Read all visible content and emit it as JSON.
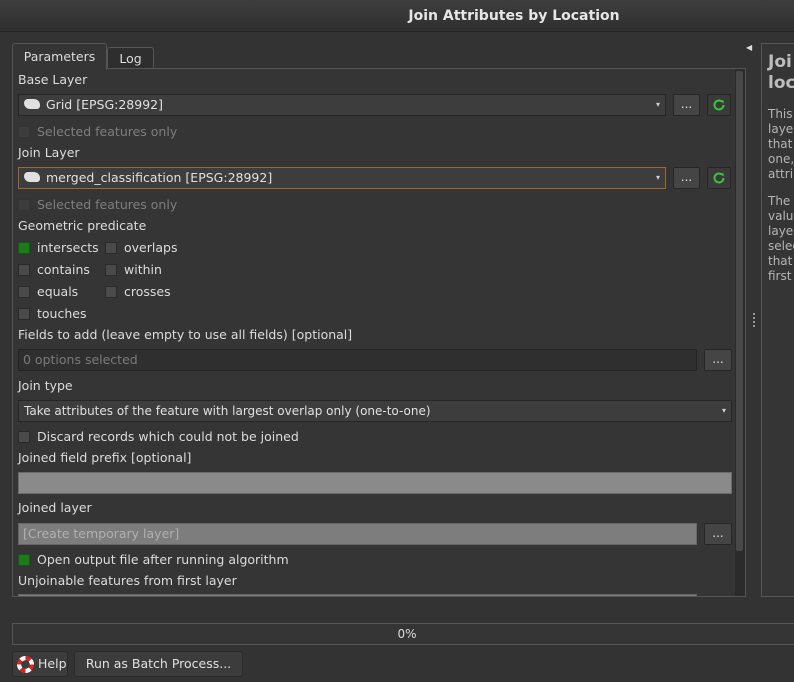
{
  "window": {
    "title": "Join Attributes by Location"
  },
  "tabs": [
    {
      "label": "Parameters"
    },
    {
      "label": "Log"
    }
  ],
  "base_layer": {
    "label": "Base Layer",
    "value": "Grid [EPSG:28992]",
    "selected_only_label": "Selected features only",
    "browse_label": "..."
  },
  "join_layer": {
    "label": "Join Layer",
    "value": "merged_classification [EPSG:28992]",
    "selected_only_label": "Selected features only",
    "browse_label": "..."
  },
  "geometric_predicate": {
    "label": "Geometric predicate",
    "options": [
      {
        "label": "intersects",
        "checked": true
      },
      {
        "label": "overlaps",
        "checked": false
      },
      {
        "label": "contains",
        "checked": false
      },
      {
        "label": "within",
        "checked": false
      },
      {
        "label": "equals",
        "checked": false
      },
      {
        "label": "crosses",
        "checked": false
      },
      {
        "label": "touches",
        "checked": false
      }
    ]
  },
  "fields_to_add": {
    "label": "Fields to add (leave empty to use all fields) [optional]",
    "placeholder": "0 options selected",
    "browse_label": "..."
  },
  "join_type": {
    "label": "Join type",
    "value": "Take attributes of the feature with largest overlap only (one-to-one)"
  },
  "discard": {
    "label": "Discard records which could not be joined",
    "checked": false
  },
  "prefix": {
    "label": "Joined field prefix [optional]",
    "value": ""
  },
  "joined_layer": {
    "label": "Joined layer",
    "placeholder": "[Create temporary layer]",
    "browse_label": "..."
  },
  "open_output": {
    "label": "Open output file after running algorithm",
    "checked": true
  },
  "unjoinable": {
    "label": "Unjoinable features from first layer"
  },
  "help_panel": {
    "title_lines": [
      "Joi",
      "loc"
    ],
    "paragraph1": [
      "This",
      "laye",
      "that",
      "one,",
      "attri"
    ],
    "paragraph2": [
      "The",
      "valu",
      "laye",
      "selec",
      "that",
      "first"
    ]
  },
  "progress": {
    "text": "0%",
    "value": 0
  },
  "buttons": {
    "help": "Help",
    "batch": "Run as Batch Process..."
  },
  "colors": {
    "check_on": "#1d7a1d",
    "focus_border": "#a0682e"
  }
}
